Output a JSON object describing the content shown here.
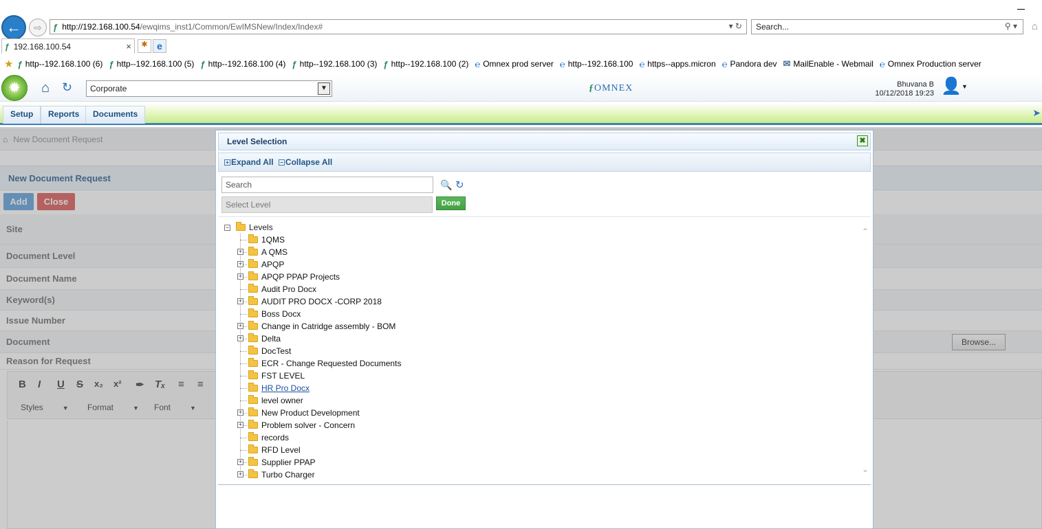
{
  "browser": {
    "url_host": "http://192.168.100.54",
    "url_path": "/ewqims_inst1/Common/EwIMSNew/Index/Index#",
    "search_placeholder": "Search...",
    "tab_title": "192.168.100.54",
    "bookmarks": [
      {
        "label": "http--192.168.100 (6)",
        "icon": "omnex-favicon"
      },
      {
        "label": "http--192.168.100 (5)",
        "icon": "omnex-favicon"
      },
      {
        "label": "http--192.168.100 (4)",
        "icon": "omnex-favicon"
      },
      {
        "label": "http--192.168.100 (3)",
        "icon": "omnex-favicon"
      },
      {
        "label": "http--192.168.100 (2)",
        "icon": "omnex-favicon"
      },
      {
        "label": "Omnex prod server",
        "icon": "ie-page-icon"
      },
      {
        "label": "http--192.168.100",
        "icon": "ie-page-icon"
      },
      {
        "label": "https--apps.micron",
        "icon": "ie-page-icon"
      },
      {
        "label": "Pandora dev",
        "icon": "ie-page-icon"
      },
      {
        "label": "MailEnable - Webmail",
        "icon": "mail-icon"
      },
      {
        "label": "Omnex Production server",
        "icon": "ie-page-icon"
      }
    ]
  },
  "header": {
    "site_value": "Corporate",
    "logo_text": "OMNEX",
    "user_name": "Bhuvana B",
    "datetime": "10/12/2018 19:23"
  },
  "menu": {
    "items": [
      "Setup",
      "Reports",
      "Documents"
    ]
  },
  "page": {
    "breadcrumb": "New Document Request",
    "panel_title": "New Document Request",
    "add_label": "Add",
    "close_label": "Close",
    "fields": [
      "Site",
      "Document Level",
      "Document Name",
      "Keyword(s)",
      "Issue Number",
      "Document",
      "Reason for Request"
    ],
    "browse_label": "Browse...",
    "editor": {
      "styles_label": "Styles",
      "format_label": "Format",
      "font_label": "Font"
    }
  },
  "modal": {
    "title": "Level Selection",
    "expand_all": "Expand All",
    "collapse_all": "Collapse All",
    "search_placeholder": "Search",
    "level_placeholder": "Select Level",
    "done_label": "Done",
    "root_label": "Levels",
    "levels": [
      {
        "label": "1QMS",
        "expandable": false
      },
      {
        "label": "A QMS",
        "expandable": true
      },
      {
        "label": "APQP",
        "expandable": true
      },
      {
        "label": "APQP PPAP Projects",
        "expandable": true
      },
      {
        "label": "Audit Pro Docx",
        "expandable": false
      },
      {
        "label": "AUDIT PRO DOCX -CORP 2018",
        "expandable": true
      },
      {
        "label": "Boss Docx",
        "expandable": false
      },
      {
        "label": "Change in Catridge assembly - BOM",
        "expandable": true
      },
      {
        "label": "Delta",
        "expandable": true
      },
      {
        "label": "DocTest",
        "expandable": false
      },
      {
        "label": "ECR - Change Requested Documents",
        "expandable": false
      },
      {
        "label": "FST LEVEL",
        "expandable": false
      },
      {
        "label": "HR Pro Docx",
        "expandable": false,
        "hovered": true
      },
      {
        "label": "level owner",
        "expandable": false
      },
      {
        "label": "New Product Development",
        "expandable": true
      },
      {
        "label": "Problem solver - Concern",
        "expandable": true
      },
      {
        "label": "records",
        "expandable": false
      },
      {
        "label": "RFD Level",
        "expandable": false
      },
      {
        "label": "Supplier PPAP",
        "expandable": true
      },
      {
        "label": "Turbo Charger",
        "expandable": true
      }
    ]
  }
}
